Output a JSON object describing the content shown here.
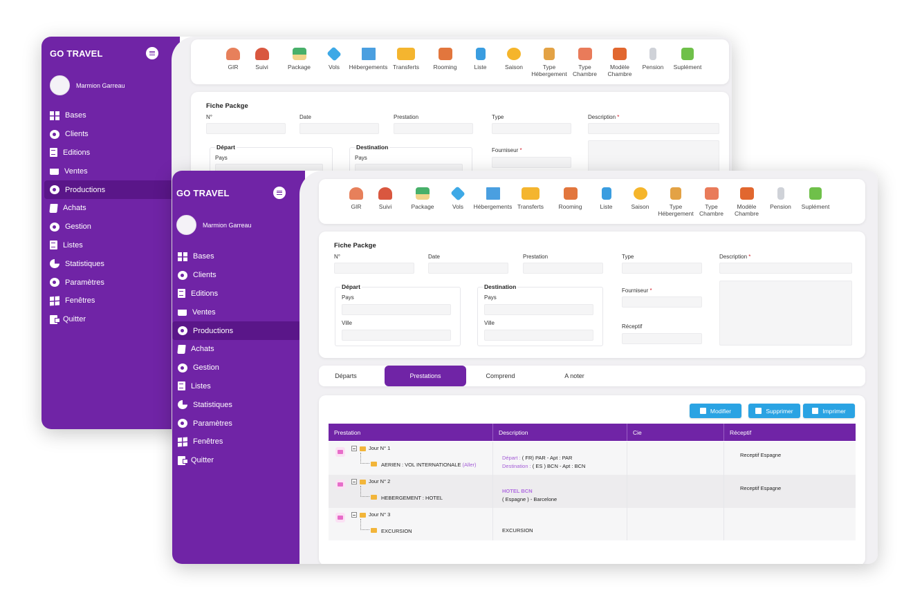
{
  "app": {
    "brand": "GO TRAVEL",
    "user": "Marmion Garreau"
  },
  "sidebar": {
    "items": [
      {
        "label": "Bases",
        "icon": "grid-icon"
      },
      {
        "label": "Clients",
        "icon": "users-icon"
      },
      {
        "label": "Editions",
        "icon": "edit-icon"
      },
      {
        "label": "Ventes",
        "icon": "cart-icon"
      },
      {
        "label": "Productions",
        "icon": "productions-icon"
      },
      {
        "label": "Achats",
        "icon": "bag-icon"
      },
      {
        "label": "Gestion",
        "icon": "gear-icon"
      },
      {
        "label": "Listes",
        "icon": "list-icon"
      },
      {
        "label": "Statistiques",
        "icon": "pie-chart-icon"
      },
      {
        "label": "Paramètres",
        "icon": "settings-icon"
      },
      {
        "label": "Fenêtres",
        "icon": "windows-icon"
      },
      {
        "label": "Quitter",
        "icon": "exit-icon"
      }
    ],
    "active": "Productions"
  },
  "toolbar": {
    "items": [
      {
        "label": "GIR",
        "icon": "group-icon",
        "color": "#e7805b"
      },
      {
        "label": "Suivi",
        "icon": "people-icon",
        "color": "#d9573f"
      },
      {
        "label": "Package",
        "icon": "palm-island-icon",
        "color": "#48b06a"
      },
      {
        "label": "Vols",
        "icon": "plane-icon",
        "color": "#3ea9e6"
      },
      {
        "label": "Hébergements",
        "icon": "buildings-icon",
        "color": "#4a9fe0"
      },
      {
        "label": "Transferts",
        "icon": "bus-icon",
        "color": "#f4b52f"
      },
      {
        "label": "Rooming",
        "icon": "rooming-icon",
        "color": "#e2763d"
      },
      {
        "label": "Liste",
        "icon": "checklist-icon",
        "color": "#3a9de0"
      },
      {
        "label": "Saison",
        "icon": "weather-icon",
        "color": "#f5b52b"
      },
      {
        "label": "Type Hébergement",
        "icon": "hotel-icon",
        "color": "#e3a245"
      },
      {
        "label": "Type Chambre",
        "icon": "bed-icon",
        "color": "#e97b5a"
      },
      {
        "label": "Modèle Chambre",
        "icon": "room-model-icon",
        "color": "#e1672f"
      },
      {
        "label": "Pension",
        "icon": "cutlery-icon",
        "color": "#cfd2d8"
      },
      {
        "label": "Suplément",
        "icon": "plus-icon",
        "color": "#6fc04a"
      }
    ]
  },
  "form": {
    "title": "Fiche Packge",
    "labels": {
      "num": "N°",
      "date": "Date",
      "prestation": "Prestation",
      "type": "Type",
      "description": "Description",
      "fournisseur": "Fourniseur",
      "receptif": "Réceptif",
      "depart": "Départ",
      "destination": "Destination",
      "pays": "Pays",
      "ville": "Ville"
    },
    "required_mark": "*"
  },
  "tabs": [
    {
      "label": "Départs"
    },
    {
      "label": "Prestations"
    },
    {
      "label": "Comprend"
    },
    {
      "label": "A noter"
    }
  ],
  "tabs_active": "Prestations",
  "actions": {
    "modify": "Modifier",
    "delete": "Supprimer",
    "print": "Imprimer"
  },
  "table": {
    "headers": [
      "Prestation",
      "Description",
      "Cie",
      "Réceptif"
    ],
    "rows": [
      {
        "day": "Jour N° 1",
        "item": "AERIEN : VOL INTERNATIONALE",
        "item_tag": "(Aller)",
        "desc_label1": "Départ :",
        "desc_value1": "( FR) PAR - Apt : PAR",
        "desc_label2": "Destination :",
        "desc_value2": "( ES ) BCN - Apt : BCN",
        "receptif": "Receptif Espagne",
        "icon": "plane-icon"
      },
      {
        "day": "Jour N° 2",
        "item": "HEBERGEMENT : HOTEL",
        "desc_label1": "HOTEL BCN",
        "desc_value2": "( Espagne ) - Barcelone",
        "receptif": "Receptif Espagne",
        "icon": "bed-icon"
      },
      {
        "day": "Jour N° 3",
        "item": "EXCURSION",
        "desc_value1": "EXCURSION",
        "receptif": "",
        "icon": "bus-icon"
      }
    ]
  }
}
